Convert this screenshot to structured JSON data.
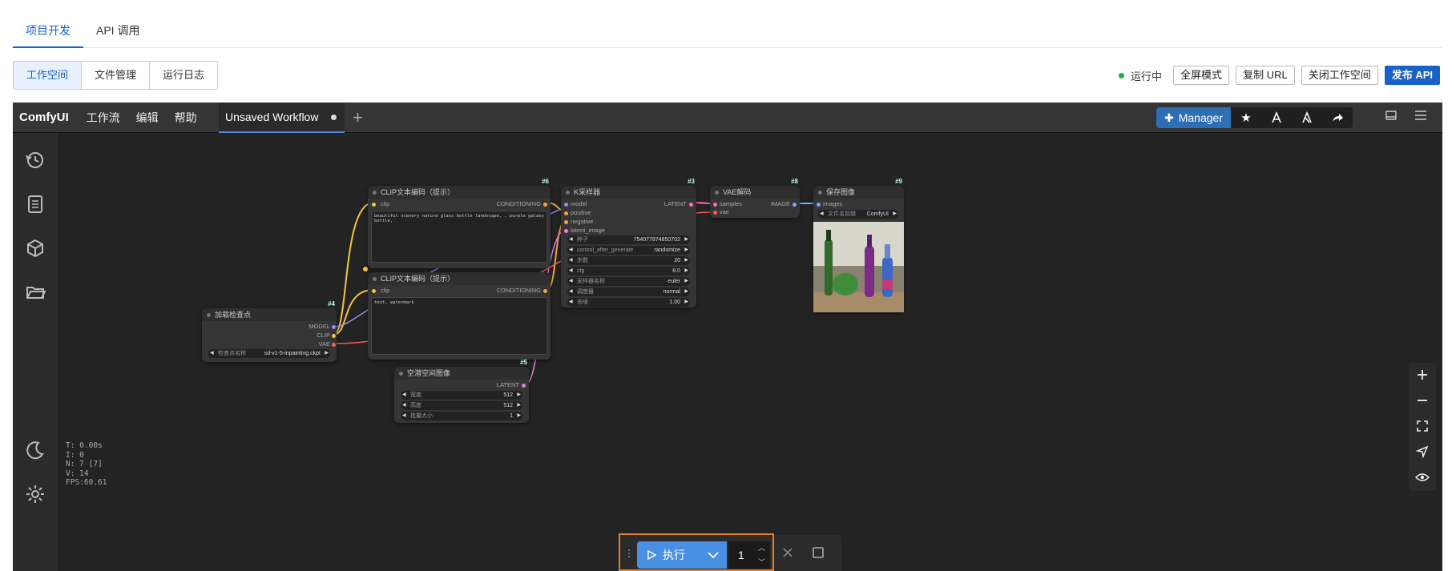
{
  "top_tabs": [
    {
      "label": "项目开发"
    },
    {
      "label": "API 调用"
    }
  ],
  "sub_tabs": [
    {
      "label": "工作空间"
    },
    {
      "label": "文件管理"
    },
    {
      "label": "运行日志"
    }
  ],
  "status": {
    "label": "运行中",
    "color": "#21b04b"
  },
  "actions": {
    "fullscreen": "全屏模式",
    "copy_url": "复制 URL",
    "close_workspace": "关闭工作空间",
    "publish_api": "发布 API"
  },
  "comfy": {
    "logo": "ComfyUI",
    "menus": [
      {
        "label": "工作流"
      },
      {
        "label": "编辑"
      },
      {
        "label": "帮助"
      }
    ],
    "workflow_tab": "Unsaved Workflow",
    "manager_label": "Manager",
    "stats": {
      "t": "T: 0.00s",
      "i": "I: 0",
      "n": "N: 7 [7]",
      "v": "V: 14",
      "fps": "FPS:60.61"
    },
    "run": {
      "label": "执行",
      "count": "1"
    }
  },
  "nodes": {
    "checkpoint": {
      "id": "#4",
      "title": "加载检查点",
      "outputs": [
        "MODEL",
        "CLIP",
        "VAE"
      ],
      "widget_label": "检查点名称",
      "widget_value": "sd-v1-5-inpainting.ckpt"
    },
    "clip_pos": {
      "id": "#6",
      "title": "CLIP文本编码（提示）",
      "input": "clip",
      "output": "CONDITIONING",
      "text": "beautiful scenery nature glass bottle landscape, , purple galaxy bottle,"
    },
    "clip_neg": {
      "id": "#7",
      "title": "CLIP文本编码（提示）",
      "input": "clip",
      "output": "CONDITIONING",
      "text": "text, watermark"
    },
    "latent": {
      "id": "#5",
      "title": "空潜空间图像",
      "output": "LATENT",
      "widgets": [
        {
          "label": "宽度",
          "value": "512"
        },
        {
          "label": "高度",
          "value": "512"
        },
        {
          "label": "批量大小",
          "value": "1"
        }
      ]
    },
    "ksampler": {
      "id": "#3",
      "title": "K采样器",
      "inputs": [
        "model",
        "positive",
        "negative",
        "latent_image"
      ],
      "output": "LATENT",
      "widgets": [
        {
          "label": "种子",
          "value": "754077874850702"
        },
        {
          "label": "control_after_generate",
          "value": "randomize"
        },
        {
          "label": "步数",
          "value": "20"
        },
        {
          "label": "cfg",
          "value": "8.0"
        },
        {
          "label": "采样器名称",
          "value": "euler"
        },
        {
          "label": "调度器",
          "value": "normal"
        },
        {
          "label": "去噪",
          "value": "1.00"
        }
      ]
    },
    "vae": {
      "id": "#8",
      "title": "VAE解码",
      "inputs": [
        "samples",
        "vae"
      ],
      "output": "IMAGE"
    },
    "save": {
      "id": "#9",
      "title": "保存图像",
      "input": "images",
      "widget_label": "文件名前缀",
      "widget_value": "ComfyUI"
    }
  }
}
